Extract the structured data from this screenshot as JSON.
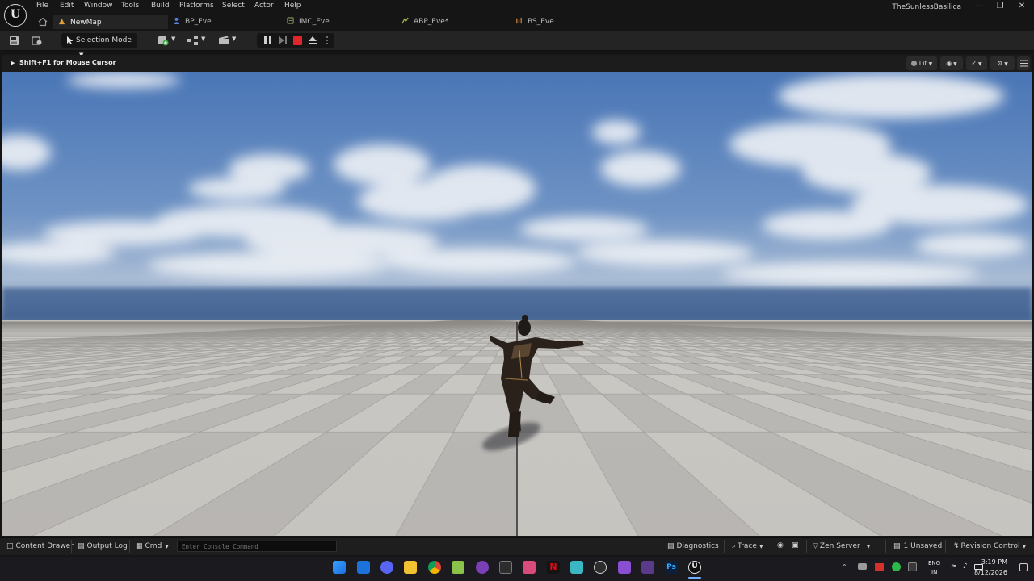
{
  "menu": {
    "items": [
      "File",
      "Edit",
      "Window",
      "Tools",
      "Build",
      "Platforms",
      "Select",
      "Actor",
      "Help"
    ],
    "project_title": "TheSunlessBasilica",
    "logo_text": "U"
  },
  "tabs": [
    {
      "label": "NewMap",
      "icon": "level-icon",
      "active": true
    },
    {
      "label": "BP_Eve",
      "icon": "blueprint-icon"
    },
    {
      "label": "IMC_Eve",
      "icon": "input-mapping-icon"
    },
    {
      "label": "ABP_Eve*",
      "icon": "anim-blueprint-icon"
    },
    {
      "label": "BS_Eve",
      "icon": "blendspace-icon"
    }
  ],
  "toolbar": {
    "selection_mode": "Selection Mode",
    "icons": [
      "save-icon",
      "content-browser-icon",
      "add-actor-icon",
      "blueprint-menu-icon",
      "cinematics-icon",
      "pause-icon",
      "step-icon",
      "stop-icon",
      "eject-icon",
      "more-icon"
    ]
  },
  "viewport": {
    "hint": "Shift+F1 for Mouse Cursor",
    "view_mode": "Lit",
    "icons": [
      "show-icon",
      "realtime-icon",
      "settings-icon",
      "grid-layout-icon"
    ],
    "colors": {
      "sky_top": "#4f79b6",
      "sky_horizon": "#c4cdd8",
      "floor_light": "#d2d0cb",
      "floor_dark": "#a7a5a1"
    }
  },
  "status_bar": {
    "content_drawer": "Content Drawer",
    "output_log": "Output Log",
    "cmd": "Cmd",
    "console_placeholder": "Enter Console Command",
    "diagnostics": "Diagnostics",
    "trace": "Trace",
    "zen_server": "Zen Server",
    "unsaved": "1 Unsaved",
    "revision_control": "Revision Control"
  },
  "taskbar": {
    "apps": [
      "windows-start-icon",
      "outlook-icon",
      "discord-icon",
      "file-explorer-icon",
      "chrome-icon",
      "notepadpp-icon",
      "github-desktop-icon",
      "terminal-icon",
      "snipping-tool-icon",
      "netflix-icon",
      "app-3-icon",
      "copilot-icon",
      "visual-studio-icon",
      "davinci-icon",
      "photoshop-icon",
      "unreal-engine-icon"
    ],
    "language": "ENG",
    "region": "IN",
    "time": "3:19 PM",
    "date": "8/12/2026"
  }
}
